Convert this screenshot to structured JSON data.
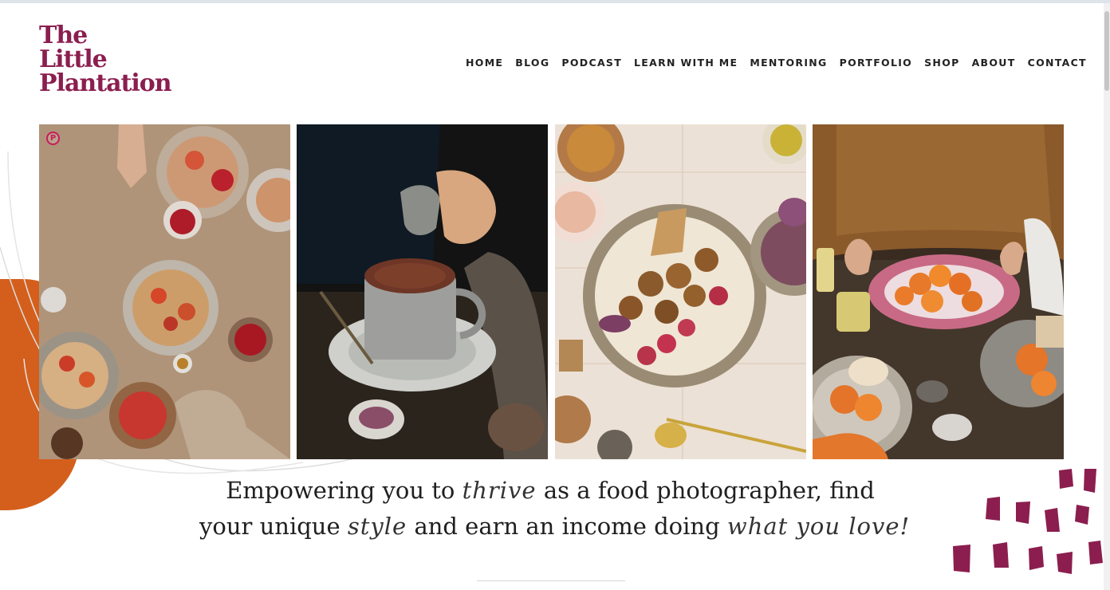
{
  "brand": {
    "logo_lines": [
      "The",
      "Little",
      "Plantation"
    ],
    "color": "#8b1e4f"
  },
  "nav": {
    "items": [
      "HOME",
      "BLOG",
      "PODCAST",
      "LEARN WITH ME",
      "MENTORING",
      "PORTFOLIO",
      "SHOP",
      "ABOUT",
      "CONTACT"
    ]
  },
  "hero": {
    "pinterest_icon": "pinterest-icon",
    "photos": [
      {
        "name": "breakfast-bowls-photo"
      },
      {
        "name": "hot-chocolate-photo"
      },
      {
        "name": "falafel-bowl-photo"
      },
      {
        "name": "pasta-plate-photo"
      }
    ]
  },
  "tagline": {
    "line1_a": "Empowering you to",
    "line1_script": "thrive",
    "line1_b": "as a food photographer,  find",
    "line2_a": "your unique",
    "line2_script": "style",
    "line2_b": "and earn an income doing",
    "line2_script2": "what you love!"
  },
  "colors": {
    "accent_orange": "#d45f1c",
    "accent_plum": "#8b1e4f"
  }
}
